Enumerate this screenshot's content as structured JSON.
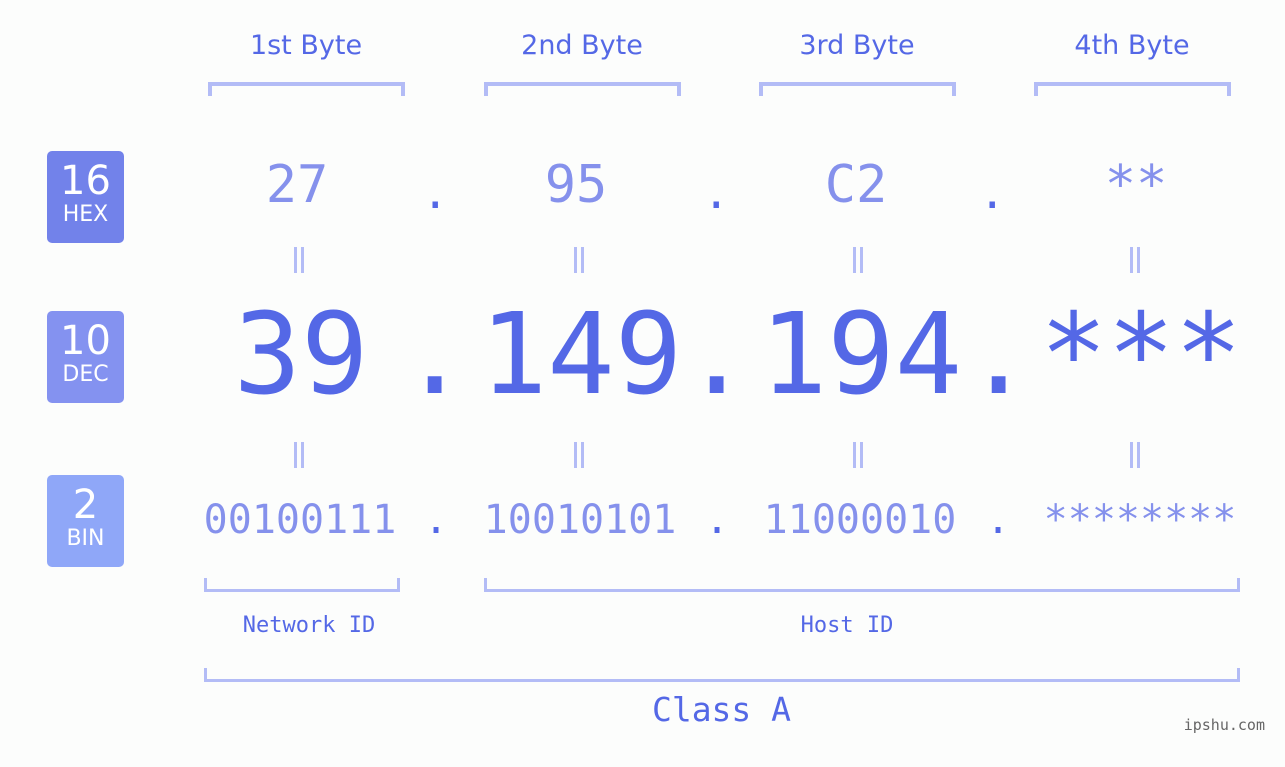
{
  "badges": [
    {
      "base": "16",
      "label": "HEX",
      "color": "#7282ea"
    },
    {
      "base": "10",
      "label": "DEC",
      "color": "#8492f0"
    },
    {
      "base": "2",
      "label": "BIN",
      "color": "#8fa7f8"
    }
  ],
  "bytes": [
    {
      "header": "1st Byte",
      "hex": "27",
      "dec": "39",
      "bin": "00100111"
    },
    {
      "header": "2nd Byte",
      "hex": "95",
      "dec": "149",
      "bin": "10010101"
    },
    {
      "header": "3rd Byte",
      "hex": "C2",
      "dec": "194",
      "bin": "11000010"
    },
    {
      "header": "4th Byte",
      "hex": "**",
      "dec": "***",
      "bin": "********"
    }
  ],
  "separator": ".",
  "network_label": "Network ID",
  "host_label": "Host ID",
  "class_label": "Class A",
  "watermark": "ipshu.com",
  "colors": {
    "primary": "#5468e6",
    "light": "#8591ec",
    "bracket": "#b3bcf6"
  }
}
